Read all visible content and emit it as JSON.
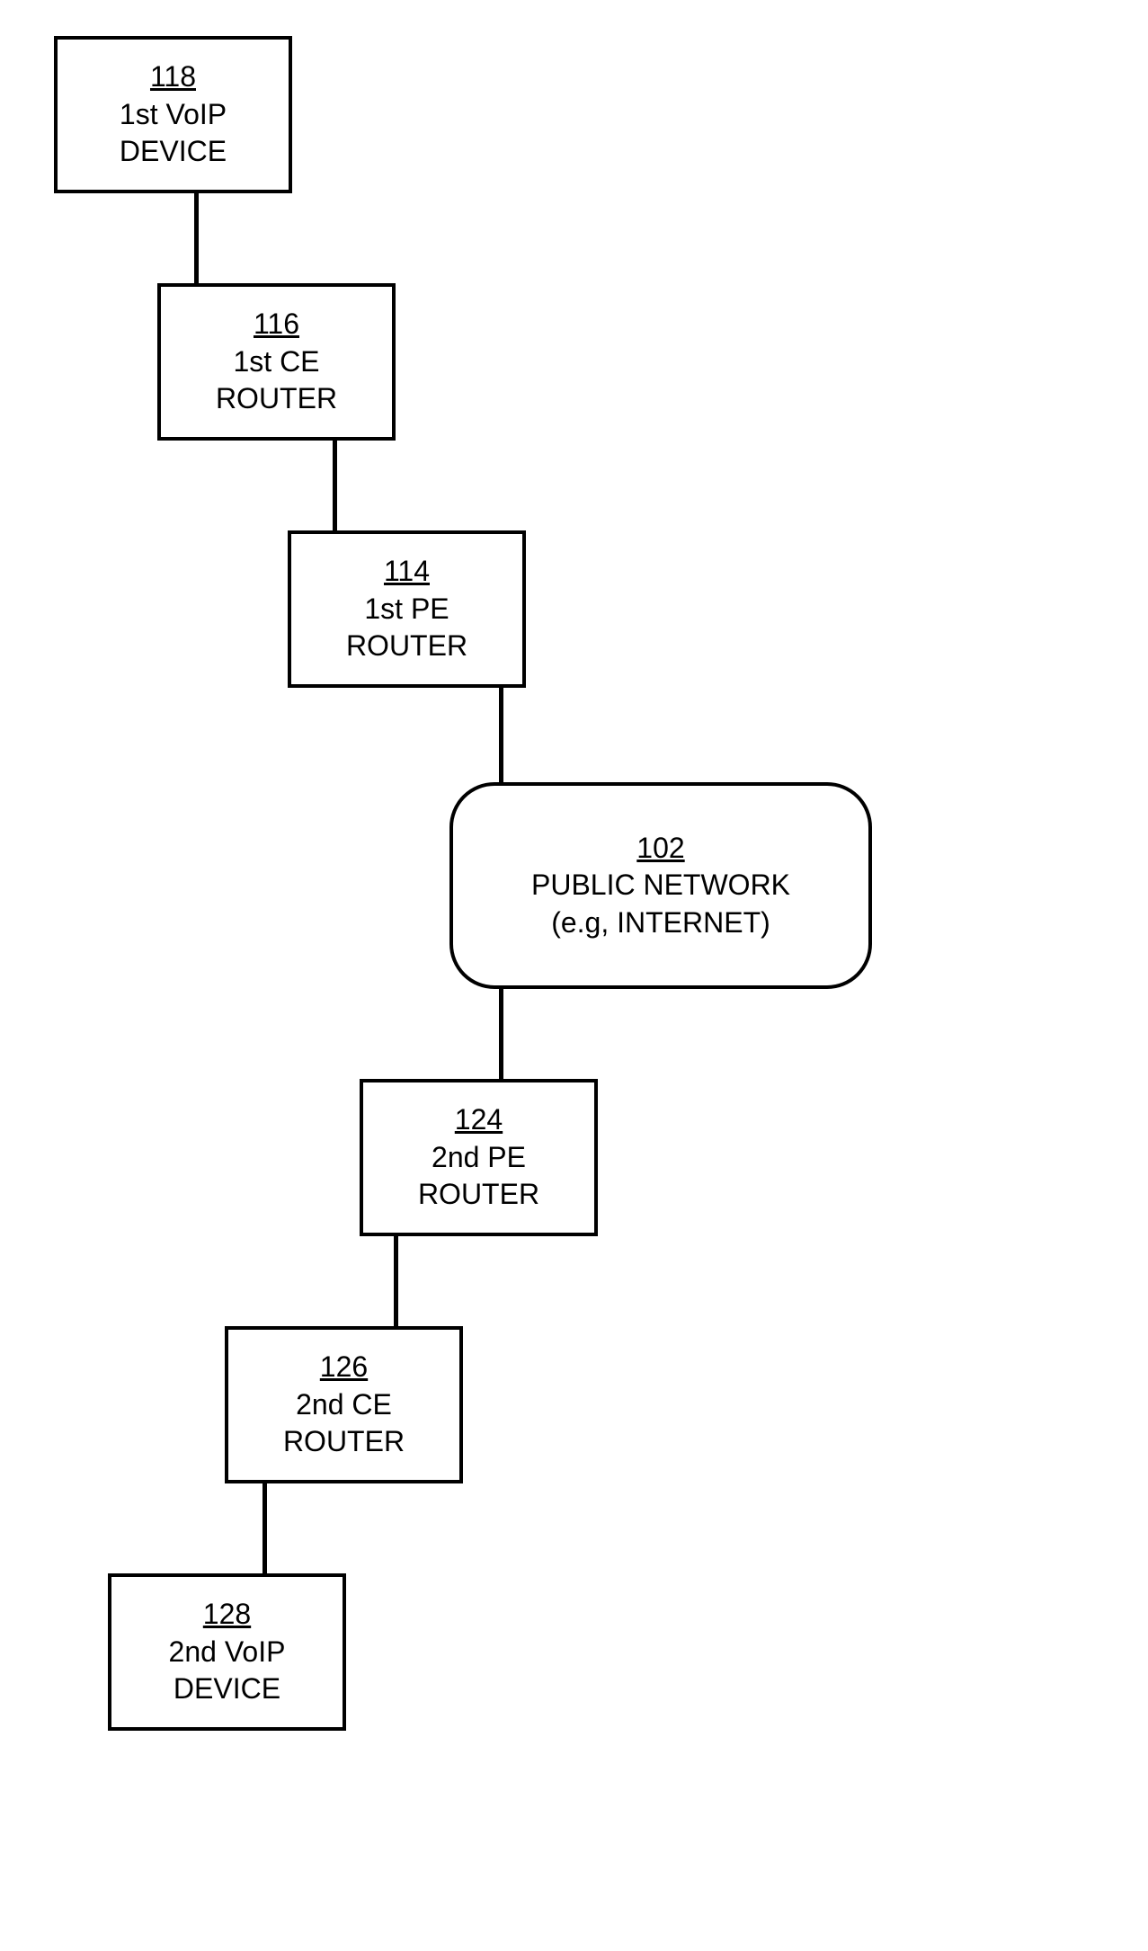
{
  "nodes": {
    "n118": {
      "ref": "118",
      "line1": "1st VoIP",
      "line2": "DEVICE"
    },
    "n116": {
      "ref": "116",
      "line1": "1st CE",
      "line2": "ROUTER"
    },
    "n114": {
      "ref": "114",
      "line1": "1st PE",
      "line2": "ROUTER"
    },
    "n102": {
      "ref": "102",
      "line1": "PUBLIC NETWORK",
      "line2": "(e.g, INTERNET)"
    },
    "n124": {
      "ref": "124",
      "line1": "2nd PE",
      "line2": "ROUTER"
    },
    "n126": {
      "ref": "126",
      "line1": "2nd CE",
      "line2": "ROUTER"
    },
    "n128": {
      "ref": "128",
      "line1": "2nd VoIP",
      "line2": "DEVICE"
    }
  }
}
